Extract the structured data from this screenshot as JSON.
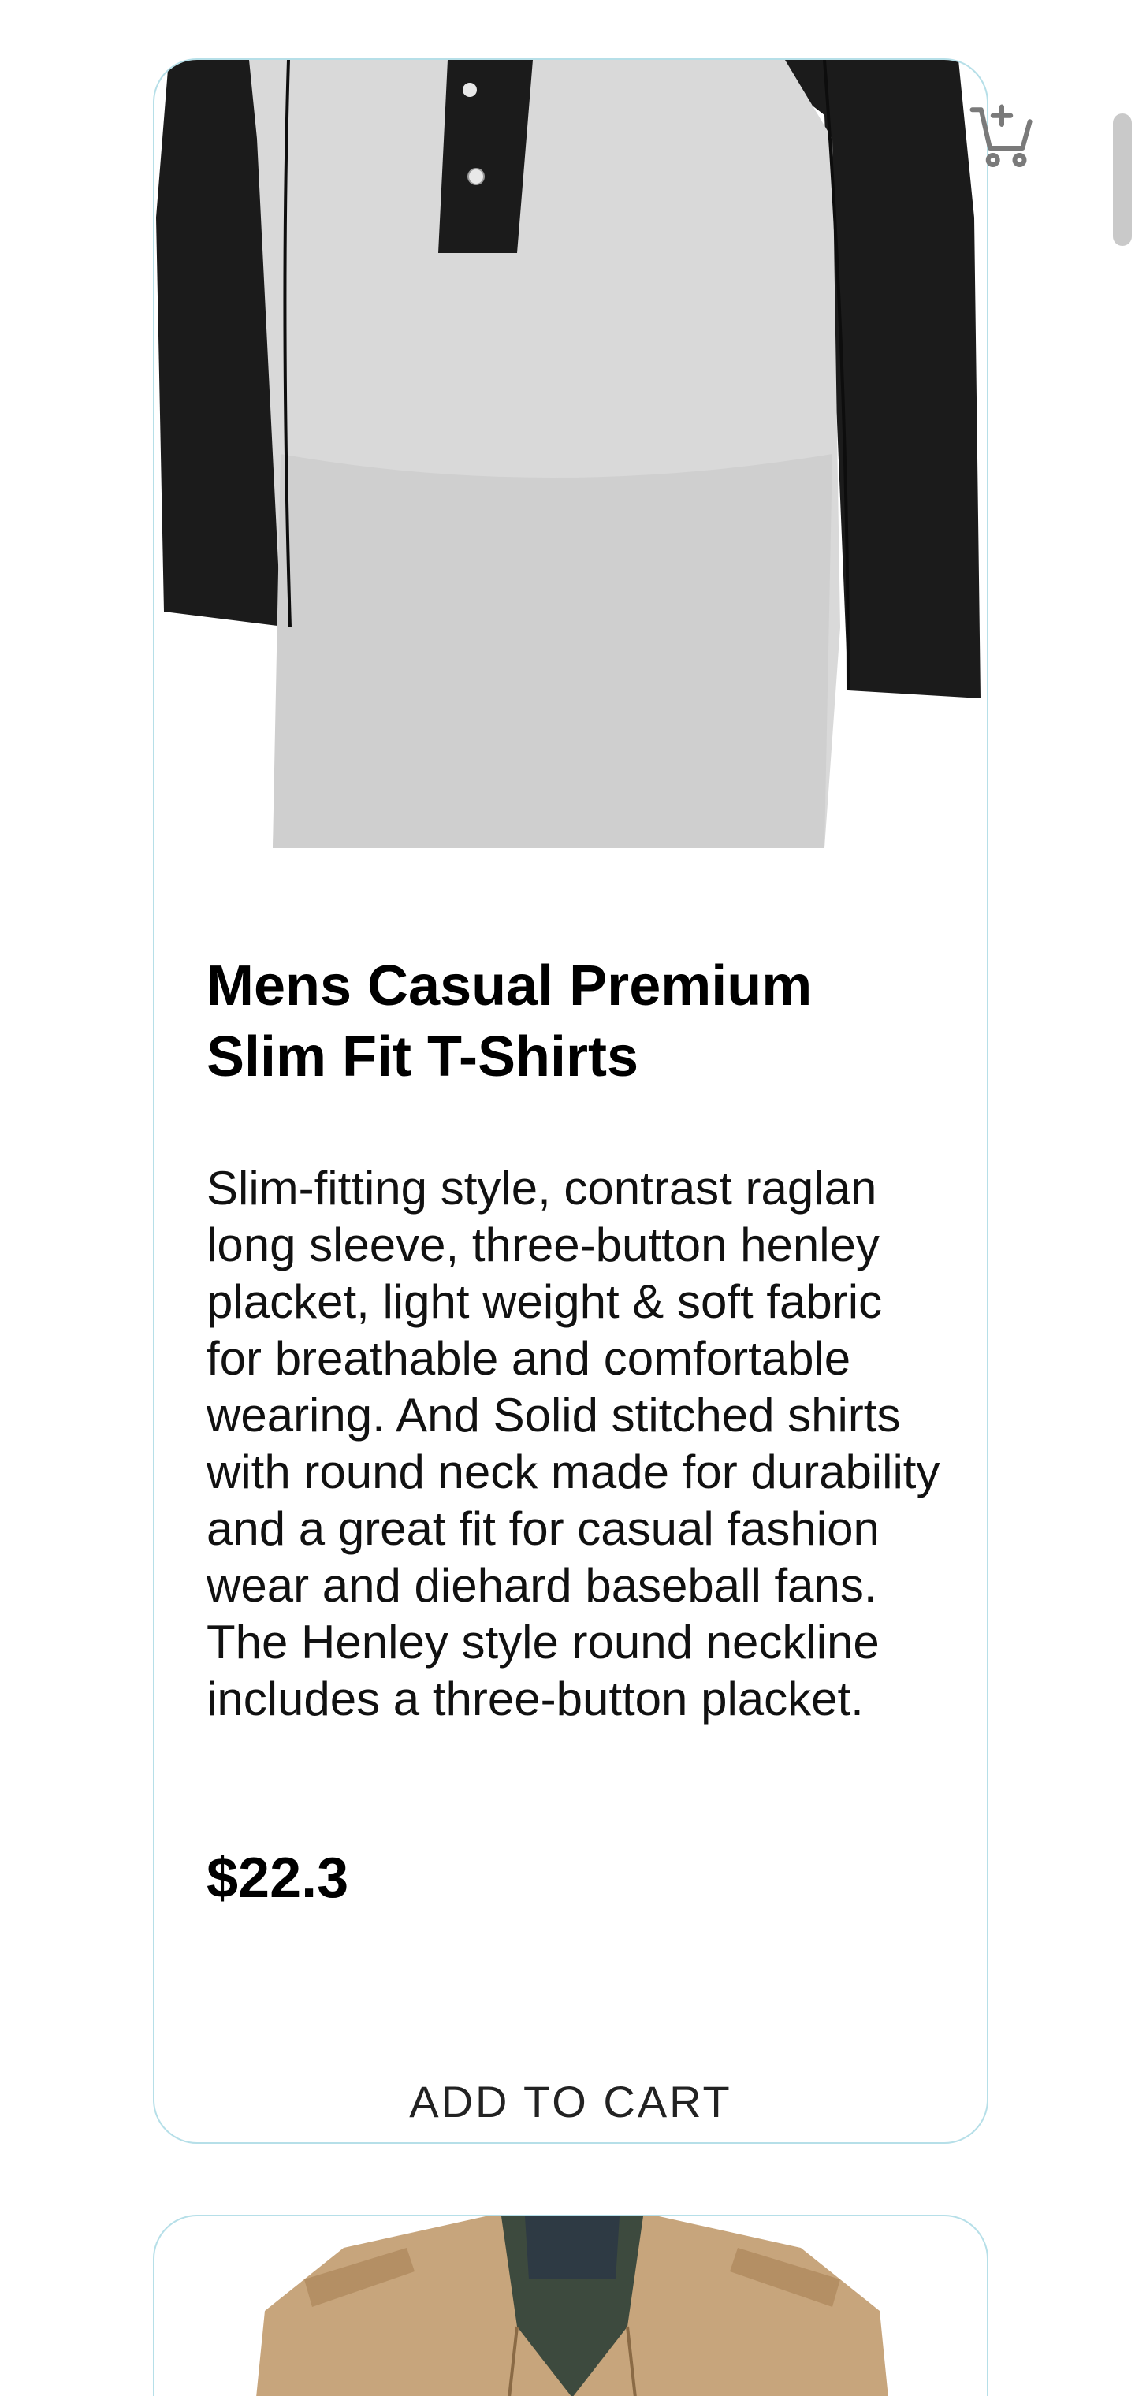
{
  "products": [
    {
      "title": "Mens Casual Premium Slim Fit T-Shirts",
      "description": "Slim-fitting style, contrast raglan long sleeve, three-button henley placket, light weight & soft fabric for breathable and comfortable wearing. And Solid stitched shirts with round neck made for durability and a great fit for casual fashion wear and diehard baseball fans. The Henley style round neckline includes a three-button placket.",
      "price": "$22.3",
      "add_to_cart_label": "ADD TO CART",
      "image_icon": "raglan-henley-shirt-image"
    },
    {
      "image_icon": "khaki-jacket-image"
    }
  ],
  "header": {
    "cart_icon": "add-shopping-cart-icon"
  },
  "colors": {
    "card_border": "#b6dfe8",
    "shirt_sleeve": "#1a1a1a",
    "shirt_body": "#d9d9d9",
    "jacket": "#c7a57c",
    "icon_gray": "#7a7a7a"
  }
}
